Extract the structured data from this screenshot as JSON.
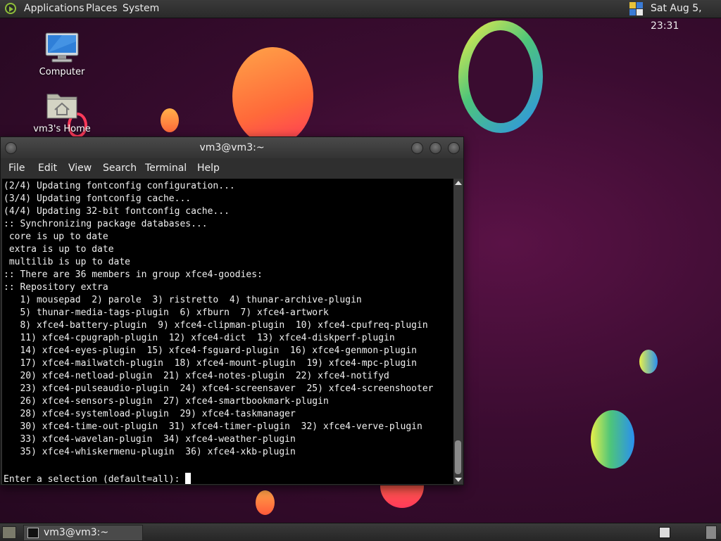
{
  "top_panel": {
    "menus": [
      "Applications",
      "Places",
      "System"
    ],
    "clock": "Sat Aug  5, 23:31"
  },
  "desktop_icons": [
    {
      "label": "Computer",
      "icon": "computer-icon"
    },
    {
      "label": "vm3's Home",
      "icon": "home-folder-icon"
    }
  ],
  "terminal": {
    "title": "vm3@vm3:~",
    "menus": [
      "File",
      "Edit",
      "View",
      "Search",
      "Terminal",
      "Help"
    ],
    "lines": [
      "(2/4) Updating fontconfig configuration...",
      "(3/4) Updating fontconfig cache...",
      "(4/4) Updating 32-bit fontconfig cache...",
      ":: Synchronizing package databases...",
      " core is up to date",
      " extra is up to date",
      " multilib is up to date",
      ":: There are 36 members in group xfce4-goodies:",
      ":: Repository extra",
      "   1) mousepad  2) parole  3) ristretto  4) thunar-archive-plugin",
      "   5) thunar-media-tags-plugin  6) xfburn  7) xfce4-artwork",
      "   8) xfce4-battery-plugin  9) xfce4-clipman-plugin  10) xfce4-cpufreq-plugin",
      "   11) xfce4-cpugraph-plugin  12) xfce4-dict  13) xfce4-diskperf-plugin",
      "   14) xfce4-eyes-plugin  15) xfce4-fsguard-plugin  16) xfce4-genmon-plugin",
      "   17) xfce4-mailwatch-plugin  18) xfce4-mount-plugin  19) xfce4-mpc-plugin",
      "   20) xfce4-netload-plugin  21) xfce4-notes-plugin  22) xfce4-notifyd",
      "   23) xfce4-pulseaudio-plugin  24) xfce4-screensaver  25) xfce4-screenshooter",
      "   26) xfce4-sensors-plugin  27) xfce4-smartbookmark-plugin",
      "   28) xfce4-systemload-plugin  29) xfce4-taskmanager",
      "   30) xfce4-time-out-plugin  31) xfce4-timer-plugin  32) xfce4-verve-plugin",
      "   33) xfce4-wavelan-plugin  34) xfce4-weather-plugin",
      "   35) xfce4-whiskermenu-plugin  36) xfce4-xkb-plugin",
      ""
    ],
    "prompt": "Enter a selection (default=all): "
  },
  "taskbar": {
    "window_button": "vm3@vm3:~"
  }
}
